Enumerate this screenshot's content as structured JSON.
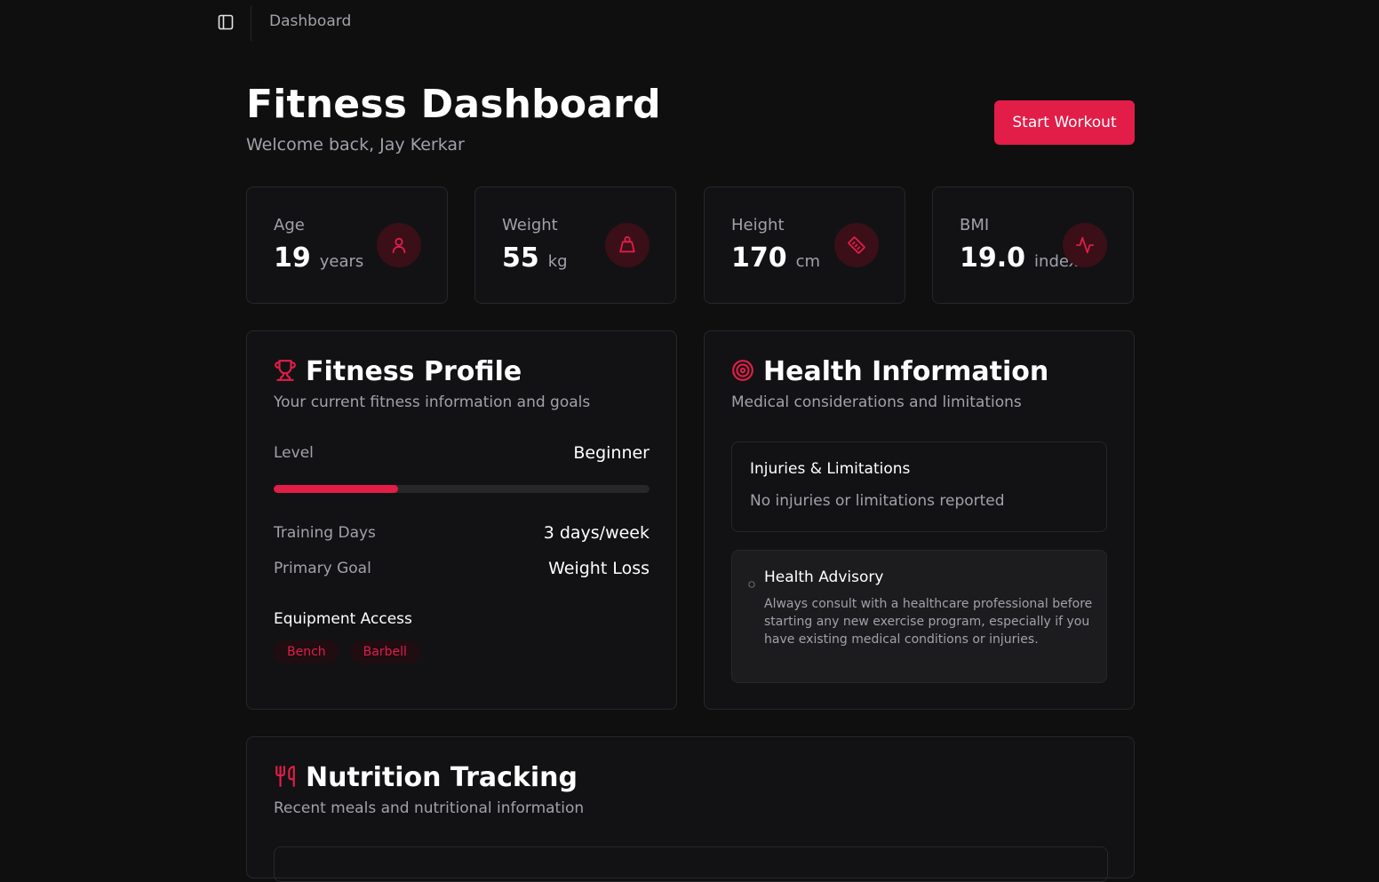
{
  "topbar": {
    "breadcrumb": "Dashboard"
  },
  "header": {
    "title": "Fitness Dashboard",
    "subtitle": "Welcome back, Jay Kerkar",
    "start_button": "Start Workout"
  },
  "stats": [
    {
      "label": "Age",
      "value": "19",
      "unit": "years",
      "icon": "user-icon"
    },
    {
      "label": "Weight",
      "value": "55",
      "unit": "kg",
      "icon": "weight-icon"
    },
    {
      "label": "Height",
      "value": "170",
      "unit": "cm",
      "icon": "ruler-icon"
    },
    {
      "label": "BMI",
      "value": "19.0",
      "unit": "index",
      "icon": "activity-icon"
    }
  ],
  "fitness_profile": {
    "title": "Fitness Profile",
    "subtitle": "Your current fitness information and goals",
    "level_label": "Level",
    "level_value": "Beginner",
    "level_progress": 0.33,
    "training_days_label": "Training Days",
    "training_days_value": "3 days/week",
    "primary_goal_label": "Primary Goal",
    "primary_goal_value": "Weight Loss",
    "equipment_title": "Equipment Access",
    "equipment": [
      "Bench",
      "Barbell"
    ]
  },
  "health_info": {
    "title": "Health Information",
    "subtitle": "Medical considerations and limitations",
    "injuries_title": "Injuries & Limitations",
    "injuries_text": "No injuries or limitations reported",
    "advisory_title": "Health Advisory",
    "advisory_text": "Always consult with a healthcare professional before starting any new exercise program, especially if you have existing medical conditions or injuries."
  },
  "nutrition": {
    "title": "Nutrition Tracking",
    "subtitle": "Recent meals and nutritional information"
  },
  "colors": {
    "accent": "#e11d48",
    "background": "#0f0f10",
    "card": "#121214",
    "border": "#27272a"
  }
}
